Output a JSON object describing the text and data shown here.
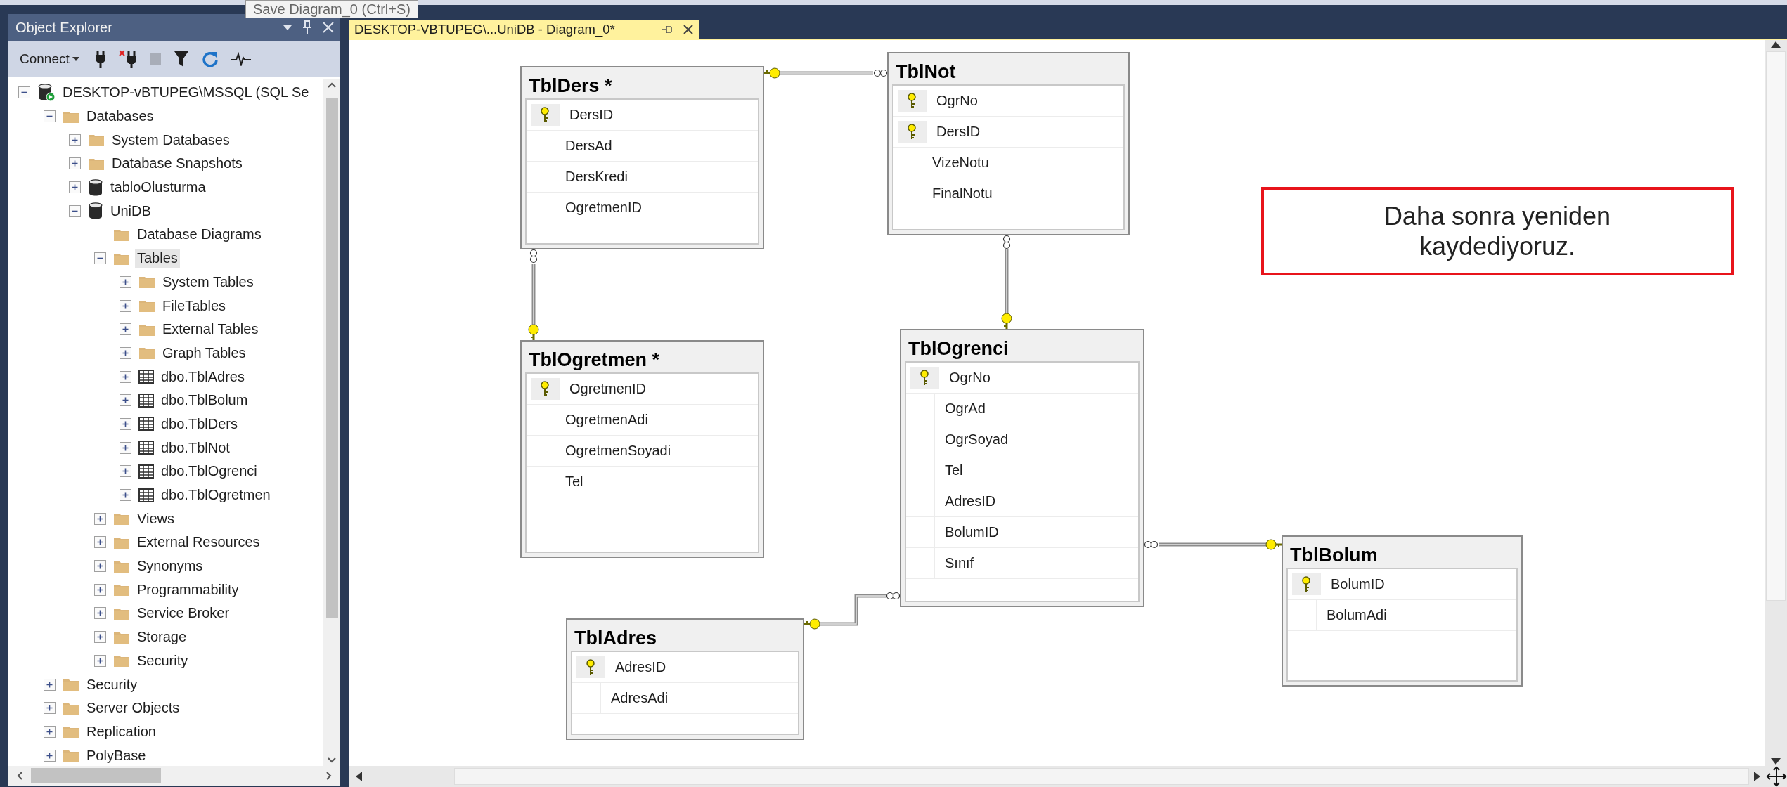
{
  "tooltip": "Save Diagram_0 (Ctrl+S)",
  "object_explorer": {
    "title": "Object Explorer",
    "toolbar": {
      "connect": "Connect"
    },
    "tree": [
      {
        "label": "DESKTOP-vBTUPEG\\MSSQL (SQL Se",
        "kind": "server",
        "expanded": true,
        "selected": false,
        "children": [
          {
            "label": "Databases",
            "kind": "folder",
            "expanded": true,
            "selected": false,
            "children": [
              {
                "label": "System Databases",
                "kind": "folder",
                "expanded": false,
                "selected": false
              },
              {
                "label": "Database Snapshots",
                "kind": "folder",
                "expanded": false,
                "selected": false
              },
              {
                "label": "tabloOlusturma",
                "kind": "database",
                "expanded": false,
                "selected": false
              },
              {
                "label": "UniDB",
                "kind": "database",
                "expanded": true,
                "selected": false,
                "children": [
                  {
                    "label": "Database Diagrams",
                    "kind": "folder",
                    "selected": false
                  },
                  {
                    "label": "Tables",
                    "kind": "folder",
                    "expanded": true,
                    "selected": true,
                    "children": [
                      {
                        "label": "System Tables",
                        "kind": "folder",
                        "expanded": false,
                        "selected": false
                      },
                      {
                        "label": "FileTables",
                        "kind": "folder",
                        "expanded": false,
                        "selected": false
                      },
                      {
                        "label": "External Tables",
                        "kind": "folder",
                        "expanded": false,
                        "selected": false
                      },
                      {
                        "label": "Graph Tables",
                        "kind": "folder",
                        "expanded": false,
                        "selected": false
                      },
                      {
                        "label": "dbo.TblAdres",
                        "kind": "table",
                        "expanded": false,
                        "selected": false
                      },
                      {
                        "label": "dbo.TblBolum",
                        "kind": "table",
                        "expanded": false,
                        "selected": false
                      },
                      {
                        "label": "dbo.TblDers",
                        "kind": "table",
                        "expanded": false,
                        "selected": false
                      },
                      {
                        "label": "dbo.TblNot",
                        "kind": "table",
                        "expanded": false,
                        "selected": false
                      },
                      {
                        "label": "dbo.TblOgrenci",
                        "kind": "table",
                        "expanded": false,
                        "selected": false
                      },
                      {
                        "label": "dbo.TblOgretmen",
                        "kind": "table",
                        "expanded": false,
                        "selected": false
                      }
                    ]
                  },
                  {
                    "label": "Views",
                    "kind": "folder",
                    "expanded": false,
                    "selected": false
                  },
                  {
                    "label": "External Resources",
                    "kind": "folder",
                    "expanded": false,
                    "selected": false
                  },
                  {
                    "label": "Synonyms",
                    "kind": "folder",
                    "expanded": false,
                    "selected": false
                  },
                  {
                    "label": "Programmability",
                    "kind": "folder",
                    "expanded": false,
                    "selected": false
                  },
                  {
                    "label": "Service Broker",
                    "kind": "folder",
                    "expanded": false,
                    "selected": false
                  },
                  {
                    "label": "Storage",
                    "kind": "folder",
                    "expanded": false,
                    "selected": false
                  },
                  {
                    "label": "Security",
                    "kind": "folder",
                    "expanded": false,
                    "selected": false
                  }
                ]
              }
            ]
          },
          {
            "label": "Security",
            "kind": "folder",
            "expanded": false,
            "selected": false
          },
          {
            "label": "Server Objects",
            "kind": "folder",
            "expanded": false,
            "selected": false
          },
          {
            "label": "Replication",
            "kind": "folder",
            "expanded": false,
            "selected": false
          },
          {
            "label": "PolyBase",
            "kind": "folder",
            "expanded": false,
            "selected": false
          }
        ]
      }
    ]
  },
  "document_tab": {
    "title": "DESKTOP-VBTUPEG\\...UniDB - Diagram_0*",
    "selected": true
  },
  "diagram": {
    "tables": [
      {
        "name": "TblDers *",
        "columns": [
          {
            "name": "DersID",
            "primary_key": true
          },
          {
            "name": "DersAd",
            "primary_key": false
          },
          {
            "name": "DersKredi",
            "primary_key": false
          },
          {
            "name": "OgretmenID",
            "primary_key": false
          }
        ]
      },
      {
        "name": "TblNot",
        "columns": [
          {
            "name": "OgrNo",
            "primary_key": true
          },
          {
            "name": "DersID",
            "primary_key": true
          },
          {
            "name": "VizeNotu",
            "primary_key": false
          },
          {
            "name": "FinalNotu",
            "primary_key": false
          }
        ]
      },
      {
        "name": "TblOgretmen *",
        "columns": [
          {
            "name": "OgretmenID",
            "primary_key": true
          },
          {
            "name": "OgretmenAdi",
            "primary_key": false
          },
          {
            "name": "OgretmenSoyadi",
            "primary_key": false
          },
          {
            "name": "Tel",
            "primary_key": false
          }
        ]
      },
      {
        "name": "TblOgrenci",
        "columns": [
          {
            "name": "OgrNo",
            "primary_key": true
          },
          {
            "name": "OgrAd",
            "primary_key": false
          },
          {
            "name": "OgrSoyad",
            "primary_key": false
          },
          {
            "name": "Tel",
            "primary_key": false
          },
          {
            "name": "AdresID",
            "primary_key": false
          },
          {
            "name": "BolumID",
            "primary_key": false
          },
          {
            "name": "Sınıf",
            "primary_key": false
          }
        ]
      },
      {
        "name": "TblAdres",
        "columns": [
          {
            "name": "AdresID",
            "primary_key": true
          },
          {
            "name": "AdresAdi",
            "primary_key": false
          }
        ]
      },
      {
        "name": "TblBolum",
        "columns": [
          {
            "name": "BolumID",
            "primary_key": true
          },
          {
            "name": "BolumAdi",
            "primary_key": false
          }
        ]
      }
    ],
    "note": "Daha sonra yeniden kaydediyoruz."
  }
}
